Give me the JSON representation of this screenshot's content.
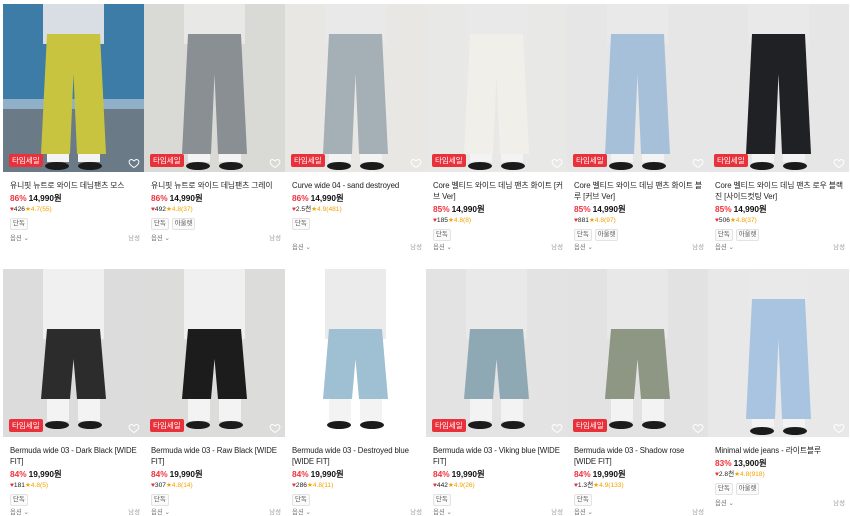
{
  "badge_label": "타임세일",
  "option_label": "옵션",
  "gender_label": "남성",
  "colors": {
    "discount": "#f0313d",
    "badge": "#e8313b",
    "star": "#f2a200"
  },
  "products": [
    {
      "name": "유니핏 뉴트로 와이드 데님팬츠 모스",
      "discount": "86%",
      "price": "14,990원",
      "likes": "426",
      "rating": "4.7(55)",
      "tags": [
        "단독"
      ],
      "has_option": true,
      "bg": "#3e7ca8",
      "pants": "#c9c440"
    },
    {
      "name": "유니핏 뉴트로 와이드 데님팬츠 그레이",
      "discount": "86%",
      "price": "14,990원",
      "likes": "492",
      "rating": "4.8(37)",
      "tags": [
        "단독",
        "아울렛"
      ],
      "has_option": true,
      "bg": "#d9d9d6",
      "pants": "#8a8f93"
    },
    {
      "name": "Curve wide 04 - sand destroyed",
      "discount": "86%",
      "price": "14,990원",
      "likes": "2.5천",
      "rating": "4.9(481)",
      "tags": [
        "단독"
      ],
      "has_option": true,
      "bg": "#e9e7e3",
      "pants": "#a4b0b5"
    },
    {
      "name": "Core 벨티드 와이드 데님 팬츠 화이트 [커브 Ver]",
      "discount": "85%",
      "price": "14,990원",
      "likes": "185",
      "rating": "4.8(8)",
      "tags": [
        "단독"
      ],
      "has_option": true,
      "bg": "#e8e8e6",
      "pants": "#f1efea"
    },
    {
      "name": "Core 벨티드 와이드 데님 팬츠 화이트 블루 [커브 Ver]",
      "discount": "85%",
      "price": "14,990원",
      "likes": "881",
      "rating": "4.8(97)",
      "tags": [
        "단독",
        "아울렛"
      ],
      "has_option": true,
      "bg": "#e6e6e6",
      "pants": "#a7c0da"
    },
    {
      "name": "Core 벨티드 와이드 데님 팬츠 로우 블랙진 [사이드컷팅 Ver]",
      "discount": "85%",
      "price": "14,990원",
      "likes": "506",
      "rating": "4.8(37)",
      "tags": [
        "단독",
        "아울렛"
      ],
      "has_option": true,
      "bg": "#e6e6e6",
      "pants": "#202124"
    },
    {
      "name": "Bermuda wide 03 - Dark Black [WIDE FIT]",
      "discount": "84%",
      "price": "19,990원",
      "likes": "181",
      "rating": "4.8(5)",
      "tags": [
        "단독"
      ],
      "has_option": true,
      "bg": "#dcdcdc",
      "pants": "#2c2c2c"
    },
    {
      "name": "Bermuda wide 03 - Raw Black [WIDE FIT]",
      "discount": "84%",
      "price": "19,990원",
      "likes": "307",
      "rating": "4.8(14)",
      "tags": [
        "단독"
      ],
      "has_option": true,
      "bg": "#dcdcdb",
      "pants": "#1c1c1d"
    },
    {
      "name": "Bermuda wide 03 - Destroyed blue [WIDE FIT]",
      "discount": "84%",
      "price": "19,990원",
      "likes": "286",
      "rating": "4.8(11)",
      "tags": [
        "단독"
      ],
      "has_option": true,
      "bg": "#ffffff",
      "pants": "#9fc0d3"
    },
    {
      "name": "Bermuda wide 03 - Viking blue [WIDE FIT]",
      "discount": "84%",
      "price": "19,990원",
      "likes": "442",
      "rating": "4.9(26)",
      "tags": [
        "단독"
      ],
      "has_option": true,
      "bg": "#e3e3e3",
      "pants": "#8fa9b4"
    },
    {
      "name": "Bermuda wide 03 - Shadow rose [WIDE FIT]",
      "discount": "84%",
      "price": "19,990원",
      "likes": "1.3천",
      "rating": "4.9(133)",
      "tags": [
        "단독"
      ],
      "has_option": true,
      "bg": "#e2e2e2",
      "pants": "#8d9784"
    },
    {
      "name": "Minimal wide jeans - 라이트블루",
      "discount": "83%",
      "price": "13,900원",
      "likes": "2.8천",
      "rating": "4.8(918)",
      "tags": [
        "단독",
        "아울렛"
      ],
      "has_option": true,
      "bg": "#e8e8e8",
      "pants": "#a9c4e0"
    }
  ]
}
